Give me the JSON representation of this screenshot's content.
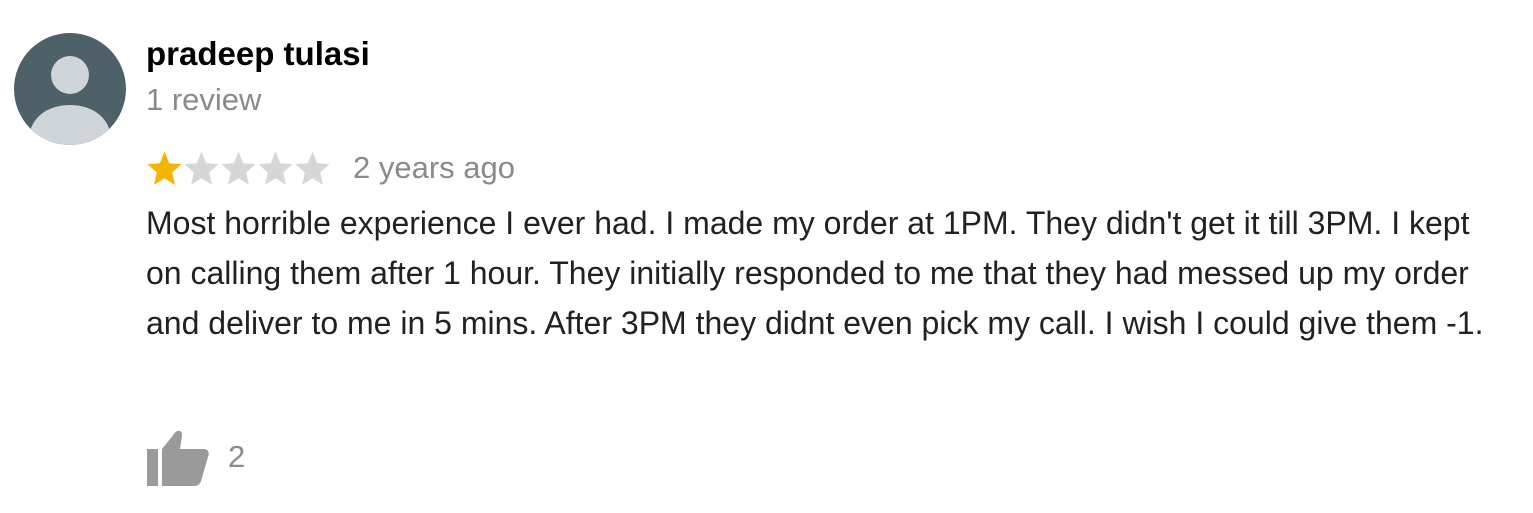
{
  "reviewer": {
    "name": "pradeep tulasi",
    "review_count": "1 review",
    "avatar_icon": "default-person-avatar-icon"
  },
  "review": {
    "rating": 1,
    "rating_max": 5,
    "timestamp": "2 years ago",
    "text": "Most horrible experience I ever had. I made my order at 1PM. They didn't get it till 3PM. I kept on calling them after 1 hour. They initially responded to me that they had messed up my order and deliver to me in 5 mins. After 3PM they didnt even pick my call. I wish I could give them -1."
  },
  "likes": {
    "icon": "thumbs-up-icon",
    "count": "2"
  },
  "colors": {
    "star_filled": "#f5b400",
    "star_empty": "#d6d6d6",
    "avatar_bg": "#4e6068",
    "avatar_figure": "#cfd5d8",
    "muted_text": "#8a8a8a",
    "thumb": "#9a9a9a"
  }
}
